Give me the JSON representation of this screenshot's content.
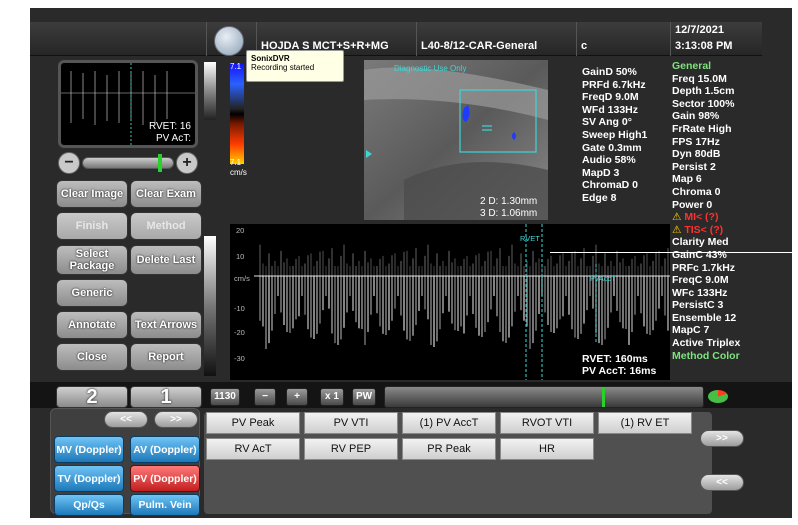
{
  "header": {
    "patient": "HOJDA S MCT+S+R+MG",
    "preset": "L40-8/12-CAR-General",
    "extra": "c",
    "date": "12/7/2021",
    "time": "3:13:08 PM"
  },
  "tooltip": {
    "title": "SonixDVR",
    "message": "Recording started"
  },
  "image2d": {
    "caption": "Diagnostic Use Only",
    "dist2": "2 D: 1.30mm",
    "dist3": "3 D: 1.06mm"
  },
  "color_scale": {
    "top": "7.1",
    "bottom": "7.1",
    "unit": "cm/s"
  },
  "thumbnail": {
    "rvet": "RVET: 16",
    "pvacct": "PV AcT:"
  },
  "zoom": {
    "minus": "−",
    "plus": "+"
  },
  "left_buttons": {
    "clear_image": "Clear Image",
    "clear_exam": "Clear Exam",
    "finish": "Finish",
    "method": "Method",
    "select_package": "Select Package",
    "delete_last": "Delete Last",
    "generic": "Generic",
    "annotate": "Annotate",
    "text_arrows": "Text Arrows",
    "close": "Close",
    "report": "Report"
  },
  "params_doppler": [
    "GainD 50%",
    "PRFd 6.7kHz",
    "FreqD 9.0M",
    "WFd 133Hz",
    "SV Ang 0°",
    "Sweep High1",
    "Gate 0.3mm",
    "Audio 58%",
    "MapD 3",
    "ChromaD 0",
    "Edge 8"
  ],
  "params_general": {
    "title": "General",
    "items": [
      "Freq 15.0M",
      "Depth 1.5cm",
      "Sector 100%",
      "Gain 98%",
      "FrRate High",
      "FPS 17Hz",
      "Dyn 80dB",
      "Persist 2",
      "Map 6",
      "Chroma 0",
      "Power 0"
    ],
    "mi": "MI< (?)",
    "tis": "TIS< (?)",
    "color_items": [
      "Clarity Med",
      "GainC 43%",
      "PRFc 1.7kHz",
      "FreqC 9.0M",
      "WFc 133Hz",
      "PersistC 3",
      "Ensemble 12",
      "MapC 7"
    ],
    "active": "Active Triplex",
    "method": "Method Color"
  },
  "doppler": {
    "scale": [
      "20",
      "10",
      "cm/s",
      "-10",
      "-20",
      "-30"
    ],
    "marker1": "RVET",
    "marker2": "PvAccT"
  },
  "measurements": {
    "rvet": "RVET: 160ms",
    "pvacct": "PV AccT: 16ms"
  },
  "toolbar": {
    "tab2": "2",
    "tab1": "1",
    "frame": "1130",
    "minus": "−",
    "plus": "+",
    "speed": "x 1",
    "pw": "PW"
  },
  "calc_nav": {
    "prev": "<<",
    "next": ">>"
  },
  "calc_buttons": [
    "PV Peak",
    "PV VTI",
    "(1) PV AccT",
    "RVOT VTI",
    "(1) RV ET",
    "RV AcT",
    "RV PEP",
    "PR Peak",
    "HR"
  ],
  "side_nav": {
    "up": ">>",
    "down": "<<"
  },
  "mode_buttons": {
    "mv": "MV (Doppler)",
    "av": "AV (Doppler)",
    "tv": "TV (Doppler)",
    "pv": "PV (Doppler)",
    "qpqs": "Qp/Qs",
    "pulm": "Pulm. Vein"
  },
  "colors": {
    "accent_green": "#7fe27f",
    "warning": "#ff3030",
    "blue_button": "#1d78b8",
    "active_button": "#c21f1f"
  }
}
